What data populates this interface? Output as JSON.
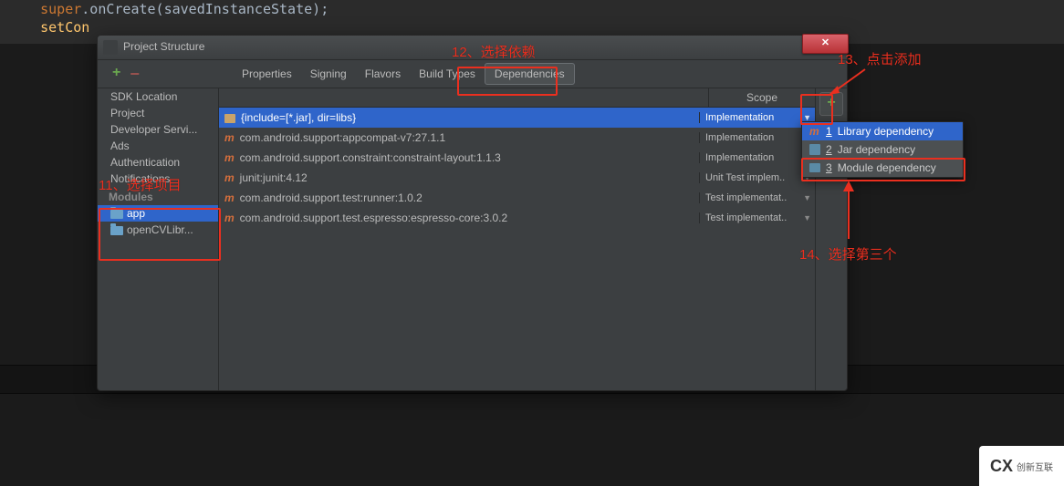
{
  "code": {
    "line1_a": "super",
    "line1_b": ".onCreate(savedInstanceState)",
    "line1_c": ";",
    "line2_a": "setCon"
  },
  "dialog": {
    "title": "Project Structure",
    "close": "✕",
    "toolbar": {
      "plus": "+",
      "minus": "−"
    },
    "tabs": [
      "Properties",
      "Signing",
      "Flavors",
      "Build Types",
      "Dependencies"
    ],
    "tabs_selected": 4,
    "sidebar": {
      "items": [
        "SDK Location",
        "Project",
        "Developer Servi...",
        "Ads",
        "Authentication",
        "Notifications"
      ],
      "modules_head": "Modules",
      "modules": [
        "app",
        "openCVLibr..."
      ],
      "modules_selected": 0
    },
    "grid": {
      "scope_header": "Scope",
      "rows": [
        {
          "icon": "dir",
          "dep": "{include=[*.jar], dir=libs}",
          "scope": "Implementation",
          "sel": true
        },
        {
          "icon": "m",
          "dep": "com.android.support:appcompat-v7:27.1.1",
          "scope": "Implementation",
          "sel": false
        },
        {
          "icon": "m",
          "dep": "com.android.support.constraint:constraint-layout:1.1.3",
          "scope": "Implementation",
          "sel": false
        },
        {
          "icon": "m",
          "dep": "junit:junit:4.12",
          "scope": "Unit Test implem..",
          "sel": false
        },
        {
          "icon": "m",
          "dep": "com.android.support.test:runner:1.0.2",
          "scope": "Test implementat..",
          "sel": false
        },
        {
          "icon": "m",
          "dep": "com.android.support.test.espresso:espresso-core:3.0.2",
          "scope": "Test implementat..",
          "sel": false
        }
      ]
    },
    "add_plus": "+"
  },
  "popup": {
    "items": [
      {
        "icon": "m",
        "num": "1",
        "label": "Library dependency"
      },
      {
        "icon": "jar",
        "num": "2",
        "label": "Jar dependency"
      },
      {
        "icon": "mod",
        "num": "3",
        "label": "Module dependency"
      }
    ],
    "hover_index": 0
  },
  "annotations": {
    "a11": "11、选择项目",
    "a12": "12、选择依赖",
    "a13": "13、点击添加",
    "a14": "14、选择第三个"
  },
  "logo": {
    "mark": "CX",
    "text": "创新互联"
  }
}
